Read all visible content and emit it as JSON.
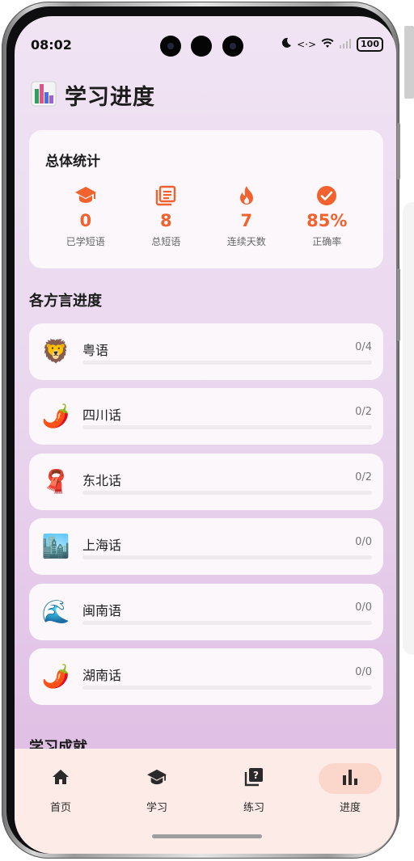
{
  "status_bar": {
    "time": "08:02",
    "battery": "100"
  },
  "header": {
    "title": "学习进度",
    "icon": "bar-chart-emoji"
  },
  "summary": {
    "title": "总体统计",
    "stats": [
      {
        "icon": "graduation-cap-icon",
        "value": "0",
        "label": "已学短语"
      },
      {
        "icon": "book-list-icon",
        "value": "8",
        "label": "总短语"
      },
      {
        "icon": "flame-icon",
        "value": "7",
        "label": "连续天数"
      },
      {
        "icon": "check-circle-icon",
        "value": "85%",
        "label": "正确率"
      }
    ]
  },
  "dialects_section": {
    "title": "各方言进度",
    "items": [
      {
        "emoji": "🦁",
        "name": "粤语",
        "count": "0/4",
        "progress": 0
      },
      {
        "emoji": "🌶️",
        "name": "四川话",
        "count": "0/2",
        "progress": 0
      },
      {
        "emoji": "🧣",
        "name": "东北话",
        "count": "0/2",
        "progress": 0
      },
      {
        "emoji": "🏙️",
        "name": "上海话",
        "count": "0/0",
        "progress": 0
      },
      {
        "emoji": "🌊",
        "name": "闽南语",
        "count": "0/0",
        "progress": 0
      },
      {
        "emoji": "🌶️",
        "name": "湖南话",
        "count": "0/0",
        "progress": 0
      }
    ]
  },
  "achievements_section": {
    "title": "学习成就"
  },
  "nav": {
    "items": [
      {
        "label": "首页",
        "icon": "home-icon",
        "active": false
      },
      {
        "label": "学习",
        "icon": "graduation-cap-icon",
        "active": false
      },
      {
        "label": "练习",
        "icon": "quiz-icon",
        "active": false
      },
      {
        "label": "进度",
        "icon": "bar-chart-icon",
        "active": true
      }
    ]
  },
  "colors": {
    "accent": "#f2622e",
    "nav_background": "#fcebe6",
    "active_pill": "#fbd6cb"
  }
}
